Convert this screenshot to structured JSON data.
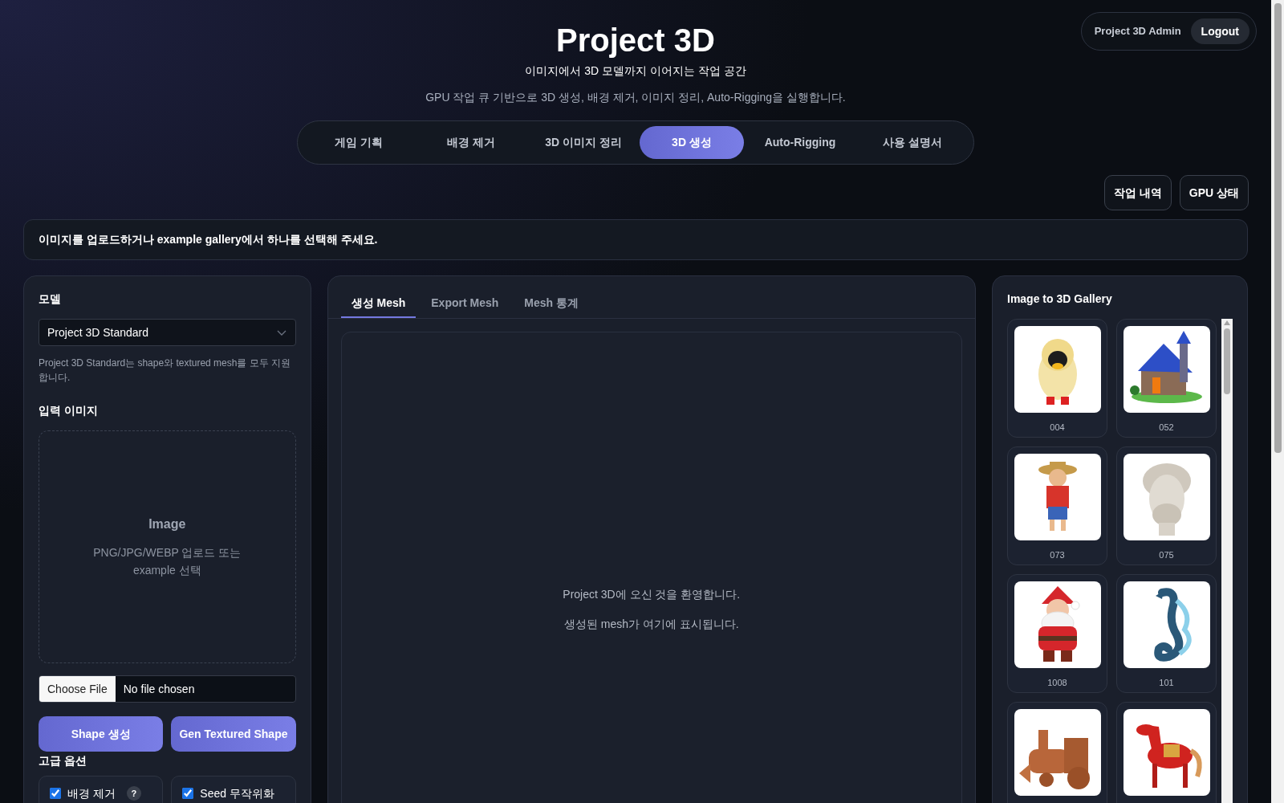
{
  "header": {
    "title": "Project 3D",
    "subtitle": "이미지에서 3D 모델까지 이어지는 작업 공간",
    "description": "GPU 작업 큐 기반으로 3D 생성, 배경 제거, 이미지 정리, Auto-Rigging을 실행합니다."
  },
  "user": {
    "name": "Project 3D Admin",
    "logout": "Logout"
  },
  "nav_tabs": [
    {
      "label": "게임 기획",
      "selected": false
    },
    {
      "label": "배경 제거",
      "selected": false
    },
    {
      "label": "3D 이미지 정리",
      "selected": false
    },
    {
      "label": "3D 생성",
      "selected": true
    },
    {
      "label": "Auto-Rigging",
      "selected": false
    },
    {
      "label": "사용 설명서",
      "selected": false
    }
  ],
  "actions": [
    "작업 내역",
    "GPU 상태"
  ],
  "notice": "이미지를 업로드하거나 example gallery에서 하나를 선택해 주세요.",
  "left_panel": {
    "model_label": "모델",
    "model_value": "Project 3D Standard",
    "model_help": "Project 3D Standard는 shape와 textured mesh를 모두 지원합니다.",
    "input_label": "입력 이미지",
    "dropzone": {
      "title": "Image",
      "hint": "PNG/JPG/WEBP 업로드 또는\nexample 선택"
    },
    "file": {
      "button": "Choose File",
      "status": "No file chosen"
    },
    "buttons": [
      "Shape 생성",
      "Gen Textured Shape"
    ],
    "advanced_label": "고급 옵션",
    "options": [
      {
        "label": "배경 제거",
        "checked": true,
        "help": "?"
      },
      {
        "label": "Seed 무작위화",
        "checked": true
      }
    ]
  },
  "viewer": {
    "tabs": [
      {
        "label": "생성 Mesh",
        "selected": true
      },
      {
        "label": "Export Mesh",
        "selected": false
      },
      {
        "label": "Mesh 통계",
        "selected": false
      }
    ],
    "messages": [
      "Project 3D에 오신 것을 환영합니다.",
      "생성된 mesh가 여기에 표시됩니다."
    ]
  },
  "gallery": {
    "title": "Image to 3D Gallery",
    "items": [
      {
        "kind": "picture",
        "label": "004"
      },
      {
        "kind": "picture",
        "label": "052"
      },
      {
        "kind": "picture",
        "label": "073"
      },
      {
        "kind": "picture",
        "label": "075"
      },
      {
        "kind": "picture",
        "label": "1008"
      },
      {
        "kind": "picture",
        "label": "101"
      },
      {
        "kind": "picture"
      },
      {
        "kind": "picture"
      }
    ]
  }
}
